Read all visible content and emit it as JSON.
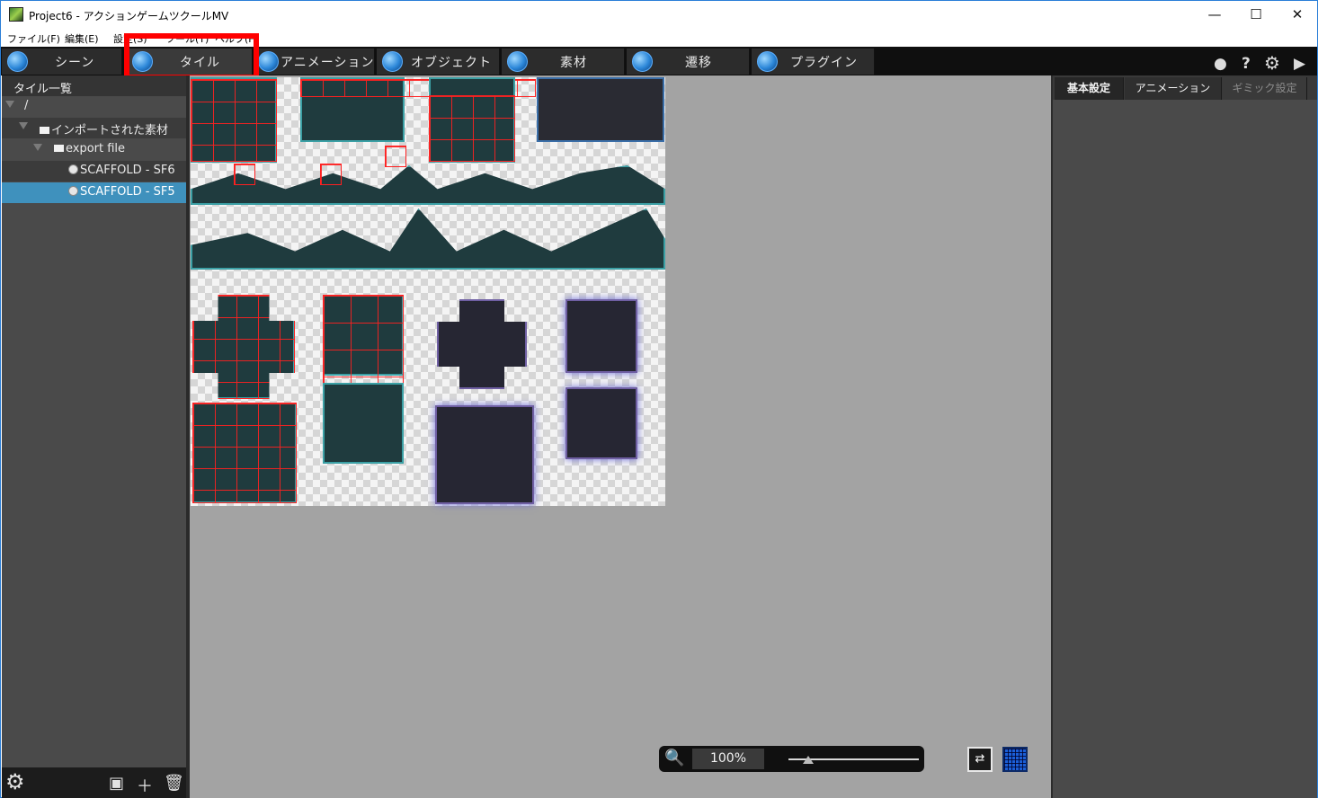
{
  "window": {
    "title": "Project6 - アクションゲームツクールMV",
    "controls": {
      "minimize": "—",
      "maximize": "☐",
      "close": "✕"
    }
  },
  "menu": {
    "items": [
      "ファイル(F)",
      "編集(E)",
      "設定(S)",
      "ツール(T)",
      "ヘルプ(H)"
    ]
  },
  "tabs": [
    {
      "label": "シーン",
      "icon": "scene-icon"
    },
    {
      "label": "タイル",
      "icon": "tile-icon",
      "active": true
    },
    {
      "label": "アニメーション",
      "icon": "animation-icon"
    },
    {
      "label": "オブジェクト",
      "icon": "object-icon"
    },
    {
      "label": "素材",
      "icon": "resource-icon"
    },
    {
      "label": "遷移",
      "icon": "transition-icon"
    },
    {
      "label": "プラグイン",
      "icon": "plugin-icon"
    }
  ],
  "toolbar_right": {
    "icons": [
      "circle-icon",
      "help-icon",
      "gear-icon",
      "play-icon"
    ]
  },
  "tile_list": {
    "header": "タイル一覧",
    "tree": [
      {
        "label": "/",
        "type": "root"
      },
      {
        "label": "インポートされた素材",
        "type": "folder"
      },
      {
        "label": "export file",
        "type": "folder"
      },
      {
        "label": "SCAFFOLD - SF6",
        "type": "tile"
      },
      {
        "label": "SCAFFOLD - SF5",
        "type": "tile",
        "selected": true
      }
    ],
    "footer_icons": [
      "settings-icon",
      "add-folder-icon",
      "add-tile-icon",
      "delete-icon"
    ]
  },
  "canvas": {
    "zoom": "100%",
    "zoom_slider_level": 0.15,
    "highlight_color": "#ff0000"
  },
  "right_panel": {
    "tabs": [
      {
        "label": "基本設定",
        "active": true
      },
      {
        "label": "アニメーション"
      },
      {
        "label": "ギミック設定",
        "disabled": true
      }
    ]
  }
}
